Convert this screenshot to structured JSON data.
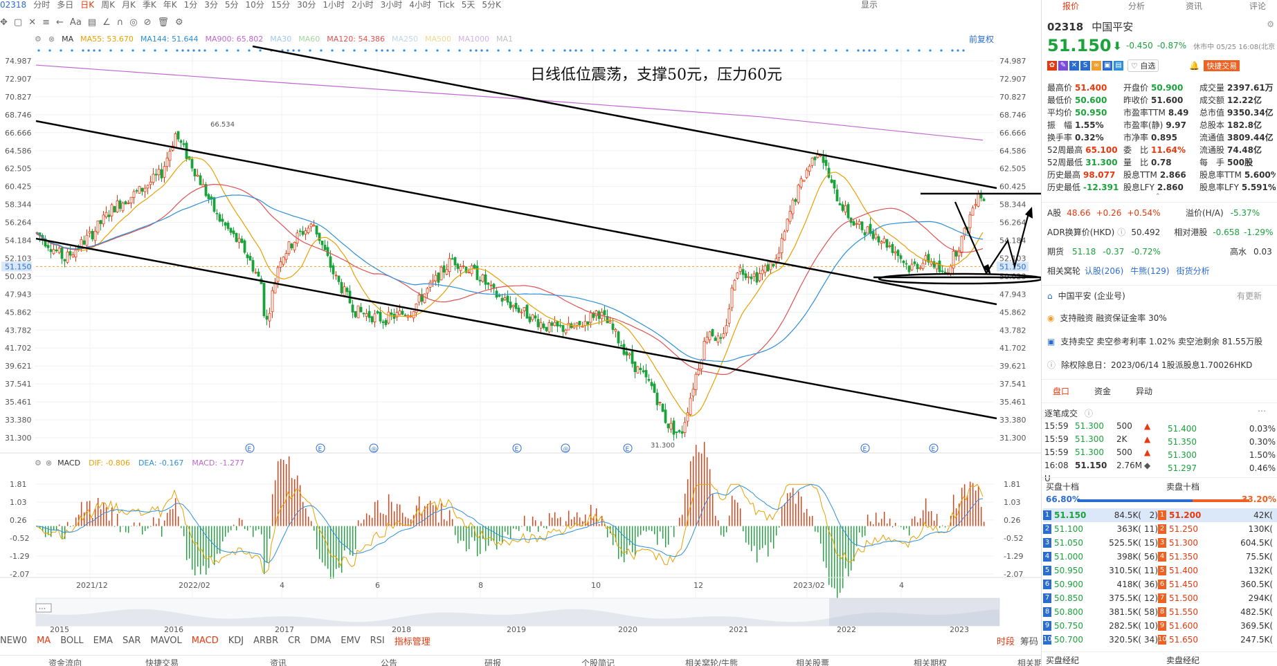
{
  "topbar": {
    "code": "02318",
    "items": [
      "分时",
      "多日",
      "日K",
      "周K",
      "月K",
      "季K",
      "年K",
      "1分",
      "3分",
      "5分",
      "10分",
      "15分",
      "30分",
      "1小时",
      "2小时",
      "3小时",
      "4小时",
      "Tick",
      "5天",
      "5分K"
    ],
    "active": "日K",
    "right": [
      "显示"
    ]
  },
  "toolbar": {
    "icons": [
      "crosshair-icon",
      "shape-icon",
      "measure-icon",
      "line-icon",
      "arrow-icon",
      "text-icon",
      "note-icon",
      "pen-icon",
      "eraser-icon",
      "delete-icon",
      "eye-icon",
      "gear-icon"
    ],
    "text": "Aa"
  },
  "ma_bar": [
    {
      "label": "MA",
      "color": "#333"
    },
    {
      "label": "MA55: 53.670",
      "color": "#e8a000"
    },
    {
      "label": "MA144: 51.644",
      "color": "#2b8fd9"
    },
    {
      "label": "MA900: 65.802",
      "color": "#c066d0"
    },
    {
      "label": "MA30",
      "color": "#a0c8f0"
    },
    {
      "label": "MA60",
      "color": "#a0d8a0"
    },
    {
      "label": "MA120: 54.386",
      "color": "#e05050"
    },
    {
      "label": "MA250",
      "color": "#c0d8e8"
    },
    {
      "label": "MA500",
      "color": "#f0d890"
    },
    {
      "label": "MA1000",
      "color": "#d8b0e8"
    },
    {
      "label": "MA1",
      "color": "#c0c0c0"
    }
  ],
  "fuquan": "前复权",
  "annotation": "日线低位震荡，支撑50元，压力60元",
  "price_axis": [
    "74.987",
    "72.907",
    "70.827",
    "68.746",
    "66.666",
    "64.586",
    "62.505",
    "60.425",
    "58.344",
    "56.264",
    "54.184",
    "52.103",
    "51.150",
    "50.023",
    "47.943",
    "45.862",
    "43.782",
    "41.702",
    "39.621",
    "37.541",
    "35.461",
    "33.380",
    "31.300"
  ],
  "current_price_label": "51.150",
  "high_label": "66.534",
  "low_label": "31.300",
  "macd_bar": {
    "label": "MACD",
    "dif": "DIF: -0.806",
    "dea": "DEA: -0.167",
    "macd": "MACD: -1.277"
  },
  "macd_axis": [
    "1.81",
    "1.03",
    "0.26",
    "-0.52",
    "-1.29",
    "-2.07"
  ],
  "date_axis": [
    "2021/12",
    "2022/02",
    "4",
    "6",
    "8",
    "10",
    "12",
    "2023/02",
    "4"
  ],
  "overview_years": [
    "2015",
    "2016",
    "2017",
    "2018",
    "2019",
    "2020",
    "2021",
    "2022",
    "2023"
  ],
  "indicator_tabs": [
    "NEW0",
    "MA",
    "BOLL",
    "EMA",
    "SAR",
    "MAVOL",
    "MACD",
    "KDJ",
    "ARBR",
    "CR",
    "DMA",
    "EMV",
    "RSI",
    "指标管理"
  ],
  "indicator_active": [
    "MA",
    "MACD"
  ],
  "indicator_right": [
    "时段",
    "筹码"
  ],
  "footer": [
    "资金流向",
    "快捷交易",
    "资讯",
    "公告",
    "研报",
    "个股简记",
    "相关窝轮/牛熊",
    "相关股票",
    "相关期权",
    "相关期货"
  ],
  "panel": {
    "tabs": [
      "报价",
      "分析",
      "资讯",
      "评论"
    ],
    "code": "02318",
    "name": "中国平安",
    "price": "51.150",
    "change": "-0.450",
    "pct": "-0.87%",
    "status": "休市中 05/25 16:08(北京",
    "add_watch": "自选",
    "quick_trade": "快捷交易",
    "stats": [
      [
        [
          "最高价",
          "51.400",
          "up"
        ],
        [
          "开盘价",
          "50.900",
          "dn"
        ],
        [
          "成交量",
          "2397.61万",
          ""
        ]
      ],
      [
        [
          "最低价",
          "50.600",
          "dn"
        ],
        [
          "昨收价",
          "51.600",
          ""
        ],
        [
          "成交额",
          "12.22亿",
          ""
        ]
      ],
      [
        [
          "平均价",
          "50.950",
          "dn"
        ],
        [
          "市盈率TTM",
          "8.49",
          ""
        ],
        [
          "总市值",
          "9350.34亿",
          ""
        ]
      ],
      [
        [
          "振　幅",
          "1.55%",
          ""
        ],
        [
          "市盈率(静)",
          "9.97",
          ""
        ],
        [
          "总股本",
          "182.8亿",
          ""
        ]
      ],
      [
        [
          "换手率",
          "0.32%",
          ""
        ],
        [
          "市净率",
          "0.895",
          ""
        ],
        [
          "流通值",
          "3809.44亿",
          ""
        ]
      ],
      [
        [
          "52周最高",
          "65.100",
          "up"
        ],
        [
          "委　比",
          "11.64%",
          "up"
        ],
        [
          "流通股",
          "74.48亿",
          ""
        ]
      ],
      [
        [
          "52周最低",
          "31.300",
          "dn"
        ],
        [
          "量　比",
          "0.78",
          ""
        ],
        [
          "每　手",
          "500股",
          ""
        ]
      ],
      [
        [
          "历史最高",
          "98.077",
          "up"
        ],
        [
          "股息TTM",
          "2.866",
          ""
        ],
        [
          "股息率TTM",
          "5.600%",
          ""
        ]
      ],
      [
        [
          "历史最低",
          "-12.391",
          "dn"
        ],
        [
          "股息LFY",
          "2.860",
          ""
        ],
        [
          "股息率LFY",
          "5.591%",
          ""
        ]
      ]
    ],
    "a_share": {
      "label": "A股",
      "price": "48.66",
      "chg": "+0.26",
      "pct": "+0.54%",
      "premium_label": "溢价(H/A)",
      "premium": "-5.37%"
    },
    "adr": {
      "label": "ADR换算价(HKD)",
      "price": "50.492",
      "rel_label": "相对港股",
      "rel": "-0.658",
      "rel_pct": "-1.29%"
    },
    "futures": {
      "label": "期货",
      "price": "51.18",
      "chg": "-0.37",
      "pct": "-0.72%",
      "right": "高水",
      "right_val": "0.03"
    },
    "warrants": {
      "label": "相关窝轮",
      "a": "认股(206)",
      "b": "牛熊(129)",
      "c": "街货分析"
    },
    "company": "中国平安 (企业号)",
    "more": "有更新",
    "margin": "支持融资  融资保证金率 30%",
    "short": "支持卖空  卖空参考利率 1.02%  卖空池剩余 81.55万股",
    "dividend": "除权除息日：2023/06/14  1股派股息1.70026HKD",
    "subtabs": [
      "盘口",
      "资金",
      "异动"
    ],
    "ticks_title": "逐笔成交",
    "ticks": [
      [
        "15:59",
        "51.300",
        "500",
        "▲"
      ],
      [
        "15:59",
        "51.300",
        "2K",
        "▲"
      ],
      [
        "15:59",
        "51.300",
        "500",
        "▲"
      ],
      [
        "16:08 U",
        "51.150",
        "2.76M",
        "◆"
      ]
    ],
    "dist": [
      [
        "51.400",
        "0.03%"
      ],
      [
        "51.350",
        "0.30%"
      ],
      [
        "51.300",
        "1.50%"
      ],
      [
        "51.297",
        "0.46%"
      ]
    ],
    "bid_title": "买盘十档",
    "ask_title": "卖盘十档",
    "bid_pct": "66.80%",
    "ask_pct": "33.20%",
    "orderbook": [
      [
        "1",
        "51.150",
        "84.5K(",
        "2)",
        "1",
        "51.200",
        "42K("
      ],
      [
        "2",
        "51.100",
        "363K(",
        "11)",
        "2",
        "51.250",
        "130K("
      ],
      [
        "3",
        "51.050",
        "525.5K(",
        "15)",
        "3",
        "51.300",
        "604.5K("
      ],
      [
        "4",
        "51.000",
        "398K(",
        "56)",
        "4",
        "51.350",
        "75.5K("
      ],
      [
        "5",
        "50.950",
        "310.5K(",
        "11)",
        "5",
        "51.400",
        "132K("
      ],
      [
        "6",
        "50.900",
        "418K(",
        "36)",
        "6",
        "51.450",
        "360.5K("
      ],
      [
        "7",
        "50.850",
        "375.5K(",
        "12)",
        "7",
        "51.500",
        "294K("
      ],
      [
        "8",
        "50.800",
        "381.5K(",
        "58)",
        "8",
        "51.550",
        "482.5K("
      ],
      [
        "9",
        "50.750",
        "282.5K(",
        "10)",
        "9",
        "51.600",
        "369.5K("
      ],
      [
        "10",
        "50.700",
        "320.5K(",
        "34)",
        "10",
        "51.650",
        "247.5K("
      ]
    ],
    "brokers": [
      "买盘经纪",
      "卖盘经纪"
    ]
  }
}
